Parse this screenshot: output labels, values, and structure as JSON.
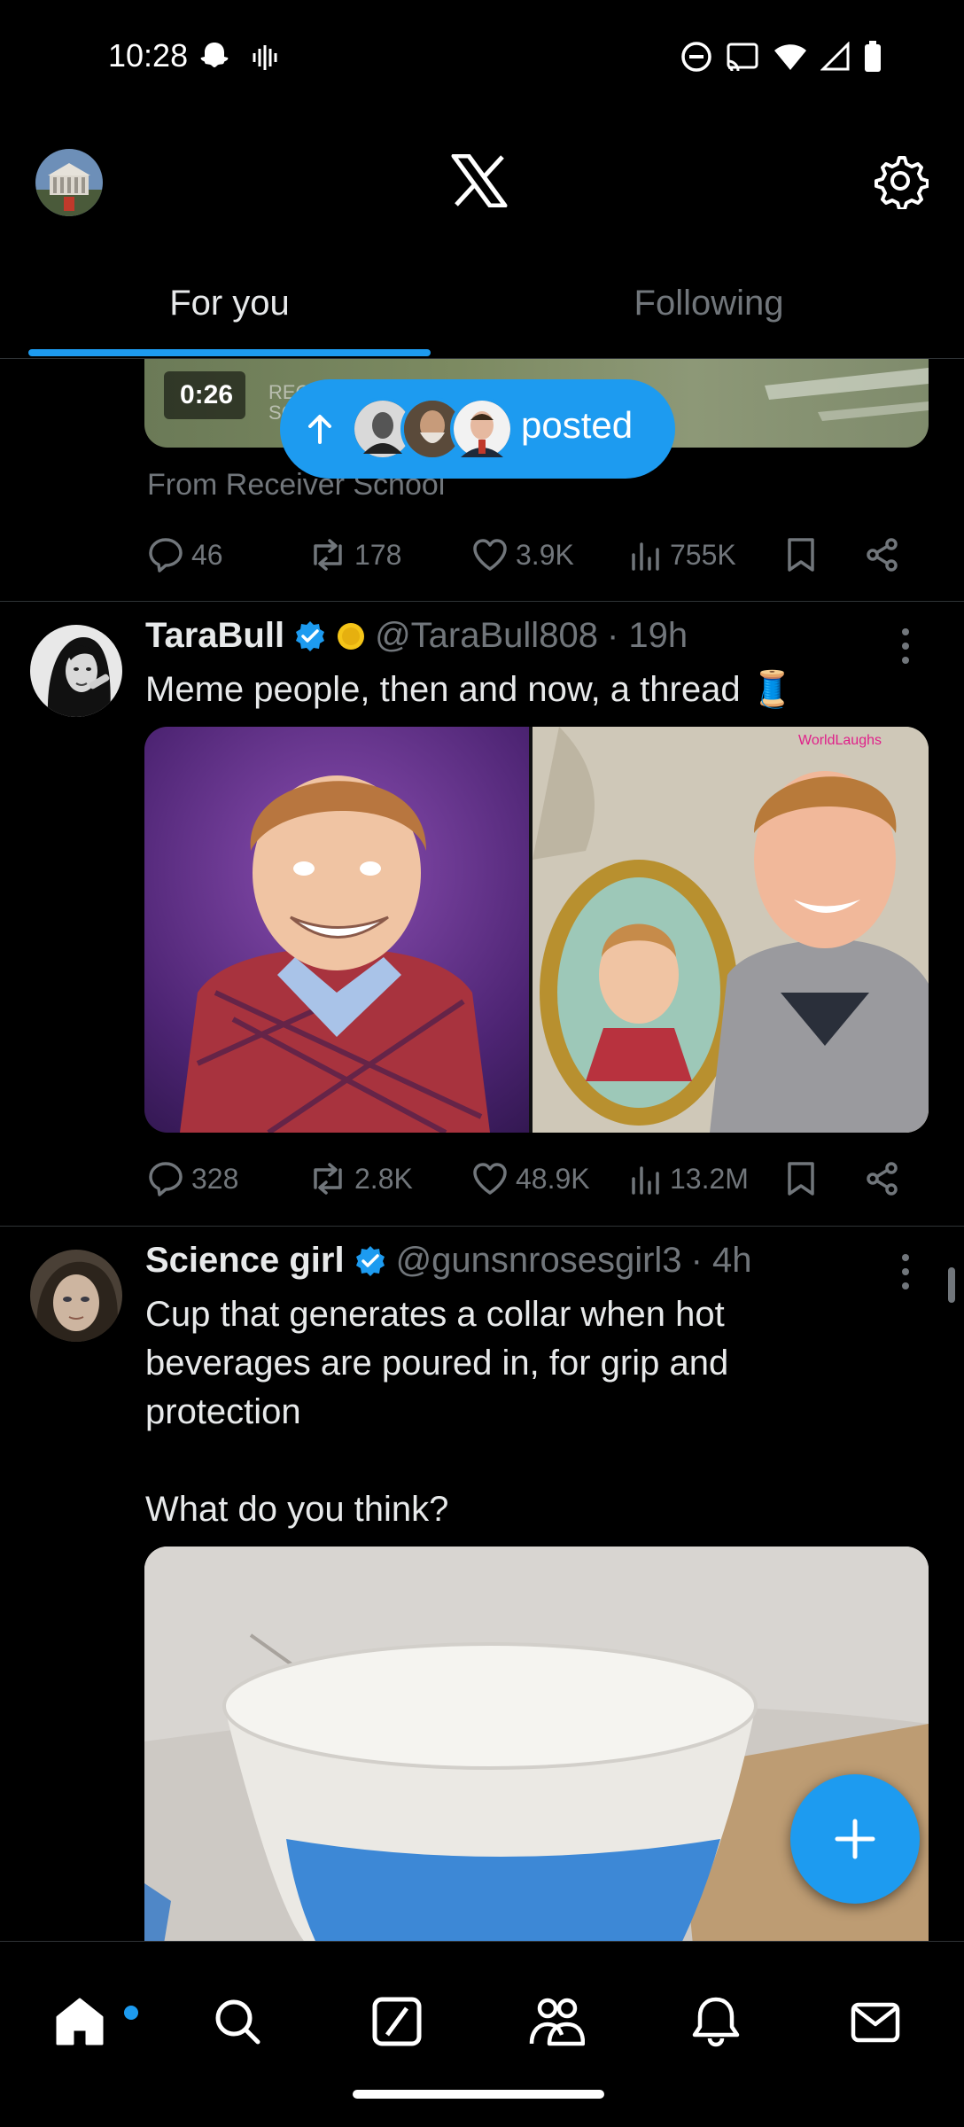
{
  "status_bar": {
    "time": "10:28",
    "left_icons": [
      "snapchat-icon",
      "voicemail-icon"
    ],
    "right_icons": [
      "do-not-disturb-icon",
      "cast-icon",
      "wifi-icon",
      "signal-icon",
      "battery-icon"
    ]
  },
  "header": {
    "logo": "X",
    "tabs": [
      {
        "label": "For you",
        "active": true
      },
      {
        "label": "Following",
        "active": false
      }
    ]
  },
  "tweets": [
    {
      "partial": true,
      "video_duration": "0:26",
      "source": "From Receiver School",
      "replies": "46",
      "reposts": "178",
      "likes": "3.9K",
      "views": "755K"
    },
    {
      "display_name": "TaraBull",
      "handle": "@TaraBull808",
      "time": "· 19h",
      "text": "Meme people, then and now, a thread 🧵",
      "replies": "328",
      "reposts": "2.8K",
      "likes": "48.9K",
      "views": "13.2M"
    },
    {
      "display_name": "Science girl",
      "handle": "@gunsnrosesgirl3",
      "time": "· 4h",
      "text": "Cup that generates a collar when hot\nbeverages are poured in, for grip and\nprotection\n\nWhat do you think?"
    }
  ],
  "new_posts_pill": {
    "label": "posted"
  },
  "colors": {
    "accent": "#1d9bf0",
    "background": "#000000",
    "text_primary": "#e7e9ea",
    "text_secondary": "#71767b"
  }
}
